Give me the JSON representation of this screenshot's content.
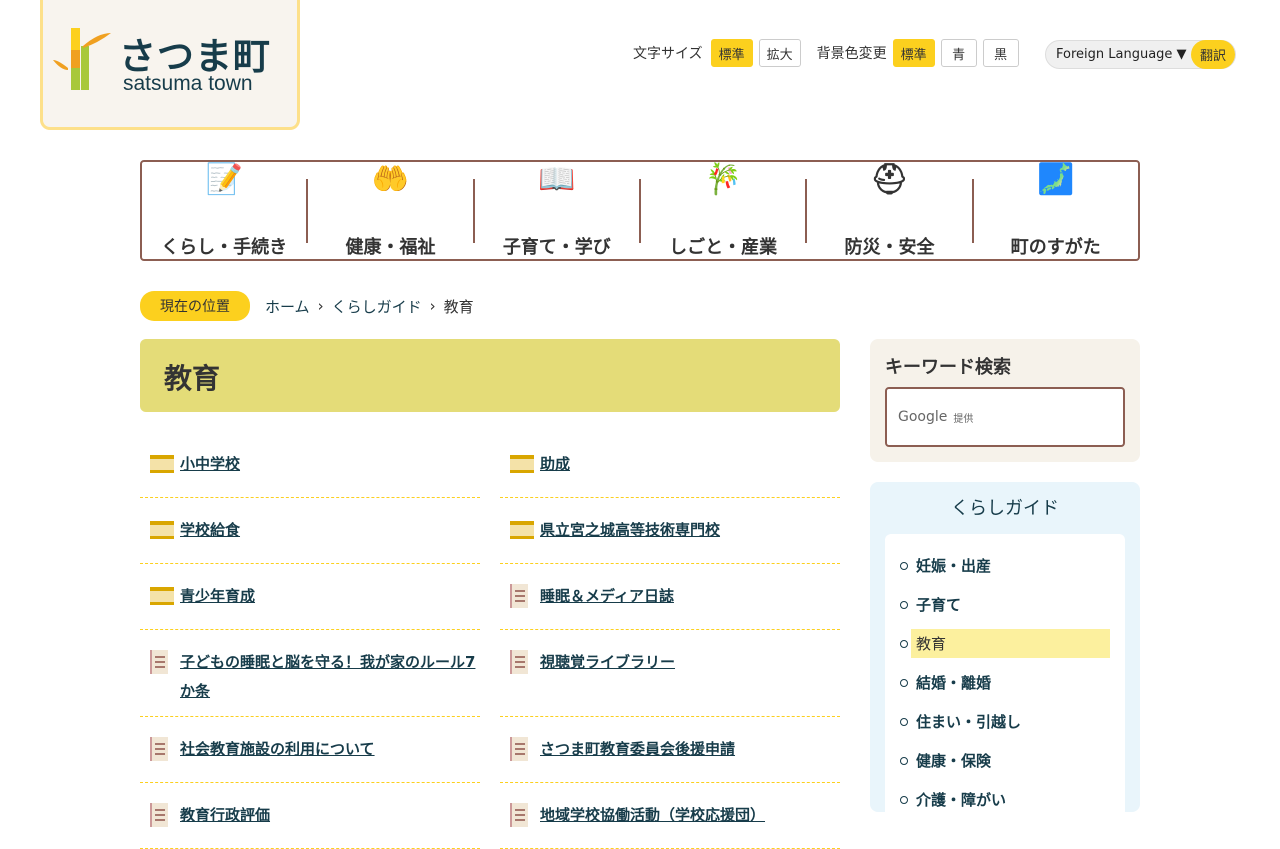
{
  "logo": {
    "jp": "さつま町",
    "en": "satsuma town"
  },
  "util": {
    "font_size_label": "文字サイズ",
    "font_standard": "標準",
    "font_large": "拡大",
    "bg_label": "背景色変更",
    "bg_standard": "標準",
    "bg_blue": "青",
    "bg_black": "黒",
    "language": "Foreign Language ▼",
    "translate": "翻訳"
  },
  "nav": [
    {
      "label": "くらし・手続き",
      "icon": "📝"
    },
    {
      "label": "健康・福祉",
      "icon": "🤲"
    },
    {
      "label": "子育て・学び",
      "icon": "📖"
    },
    {
      "label": "しごと・産業",
      "icon": "🎋"
    },
    {
      "label": "防災・安全",
      "icon": "⛑"
    },
    {
      "label": "町のすがた",
      "icon": "🗾"
    }
  ],
  "breadcrumb": {
    "here": "現在の位置",
    "items": [
      "ホーム",
      "くらしガイド",
      "教育"
    ]
  },
  "page_title": "教育",
  "left_items": [
    {
      "label": "小中学校",
      "type": "folder"
    },
    {
      "label": "学校給食",
      "type": "folder"
    },
    {
      "label": "青少年育成",
      "type": "folder"
    },
    {
      "label": "子どもの睡眠と脳を守る！我が家のルール7か条",
      "type": "doc"
    },
    {
      "label": "社会教育施設の利用について",
      "type": "doc"
    },
    {
      "label": "教育行政評価",
      "type": "doc"
    }
  ],
  "right_items": [
    {
      "label": "助成",
      "type": "folder"
    },
    {
      "label": "県立宮之城高等技術専門校",
      "type": "folder"
    },
    {
      "label": "睡眠＆メディア日誌",
      "type": "doc"
    },
    {
      "label": "視聴覚ライブラリー",
      "type": "doc"
    },
    {
      "label": "さつま町教育委員会後援申請",
      "type": "doc"
    },
    {
      "label": "地域学校協働活動（学校応援団）",
      "type": "doc"
    }
  ],
  "search": {
    "title": "キーワード検索",
    "google": "Google",
    "provided": "提供"
  },
  "guide": {
    "title": "くらしガイド",
    "items": [
      "妊娠・出産",
      "子育て",
      "教育",
      "結婚・離婚",
      "住まい・引越し",
      "健康・保険",
      "介護・障がい"
    ],
    "current": "教育"
  }
}
